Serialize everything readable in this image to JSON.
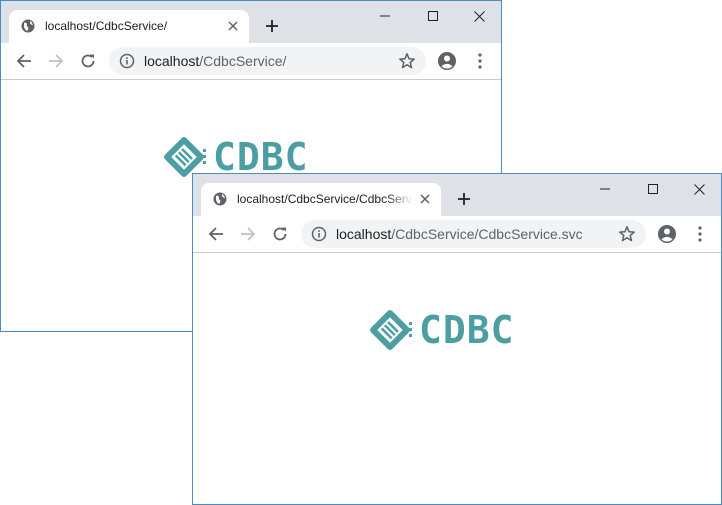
{
  "colors": {
    "accent": "#4c9ea3",
    "titlebar": "#dee1e6",
    "border": "#4a8cc4"
  },
  "window_back": {
    "tab": {
      "title": "localhost/CdbcService/",
      "icon": "globe-icon"
    },
    "address": {
      "host": "localhost",
      "path": "/CdbcService/"
    },
    "page": {
      "logo_text": "CDBC"
    }
  },
  "window_front": {
    "tab": {
      "title": "localhost/CdbcService/CdbcService.svc",
      "icon": "globe-icon"
    },
    "address": {
      "host": "localhost",
      "path": "/CdbcService/CdbcService.svc"
    },
    "page": {
      "logo_text": "CDBC"
    }
  }
}
